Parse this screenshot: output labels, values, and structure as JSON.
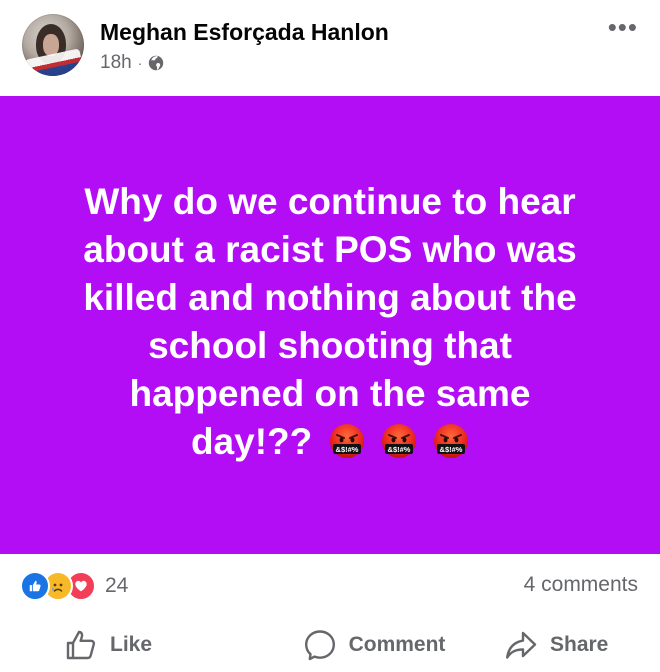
{
  "post": {
    "author": "Meghan Esforçada Hanlon",
    "time": "18h",
    "separator": "·",
    "privacy_icon": "globe-icon",
    "more_icon": "more-horizontal-icon",
    "text_lines": [
      "Why do we continue to hear",
      "about a racist POS who was",
      "killed and nothing about the",
      "school shooting that",
      "happened on the same",
      "day!??"
    ],
    "emojis": [
      "face-with-symbols-on-mouth",
      "face-with-symbols-on-mouth",
      "face-with-symbols-on-mouth"
    ],
    "background_color": "#b30df5"
  },
  "footer": {
    "reaction_icons": [
      "like-reaction-icon",
      "sad-reaction-icon",
      "love-reaction-icon"
    ],
    "reaction_count": "24",
    "comments": "4 comments"
  },
  "actions": {
    "like": "Like",
    "comment": "Comment",
    "share": "Share"
  }
}
